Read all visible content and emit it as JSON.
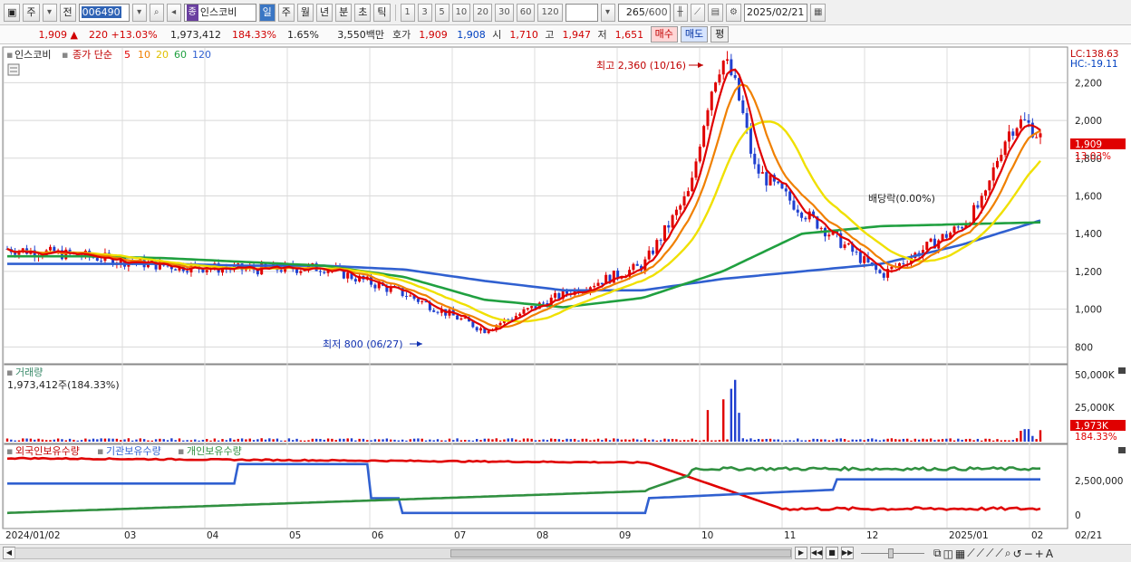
{
  "toolbar": {
    "market_label": "주",
    "prev_label": "전",
    "code": "006490",
    "stock_tag": "종",
    "stock_name": "인스코비",
    "periods": [
      "일",
      "주",
      "월",
      "년",
      "분",
      "초",
      "틱"
    ],
    "selected_period": "일",
    "intervals": [
      "1",
      "3",
      "5",
      "10",
      "20",
      "30",
      "60",
      "120"
    ],
    "count_display": "265",
    "count_total": "/600",
    "date": "2025/02/21"
  },
  "quote": {
    "price": "1,909",
    "arrow": "▲",
    "change": "220",
    "change_pct": "+13.03%",
    "volume": "1,973,412",
    "volume_ratio": "184.33%",
    "turnover": "1.65%",
    "amount": "3,550백만",
    "hoga_label": "호가",
    "ask": "1,909",
    "bid": "1,908",
    "open_label": "시",
    "open": "1,710",
    "high_label": "고",
    "high": "1,947",
    "low_label": "저",
    "low": "1,651",
    "buy_label": "매수",
    "sell_label": "매도",
    "avg_label": "평"
  },
  "price_panel": {
    "legend_name": "인스코비",
    "legend_type": "종가 단순",
    "ma_periods": [
      "5",
      "10",
      "20",
      "60",
      "120"
    ],
    "lc_label": "LC:138.63",
    "hc_label": "HC:-19.11",
    "last_price_label": "1,909",
    "last_pct_label": "13.03%",
    "high_annotation": "최고 2,360 (10/16)",
    "low_annotation": "최저 800 (06/27)",
    "dividend_annotation": "배당락(0.00%)",
    "y_ticks": [
      "2,200",
      "2,000",
      "1,800",
      "1,600",
      "1,400",
      "1,200",
      "1,000",
      "800"
    ]
  },
  "volume_panel": {
    "title": "거래량",
    "value_label": "1,973,412주(184.33%)",
    "y_ticks": [
      "50,000K",
      "25,000K"
    ],
    "last_label": "1,973K",
    "last_pct": "184.33%"
  },
  "holdings_panel": {
    "legend": [
      "외국인보유수량",
      "기관보유수량",
      "개인보유수량"
    ],
    "y_ticks": [
      "2,500,000",
      "0"
    ]
  },
  "x_axis": {
    "labels": [
      "2024/01/02",
      "03",
      "04",
      "05",
      "06",
      "07",
      "08",
      "09",
      "10",
      "11",
      "12",
      "2025/01",
      "02"
    ],
    "right_label": "02/21"
  },
  "colors": {
    "ma5": "#e00000",
    "ma10": "#f08000",
    "ma20": "#f0e000",
    "ma60": "#20a040",
    "ma120": "#3060d0",
    "up": "#e00000",
    "down": "#2040d0",
    "foreign": "#e00000",
    "institution": "#3060d0",
    "individual": "#309040"
  },
  "chart_data": {
    "type": "line",
    "title": "",
    "xlabel": "",
    "ylabel": "",
    "x": [
      "2024/01",
      "2024/02",
      "2024/03",
      "2024/04",
      "2024/05",
      "2024/06",
      "2024/07",
      "2024/08",
      "2024/09",
      "2024/10",
      "2024/11",
      "2024/12",
      "2025/01",
      "2025/02"
    ],
    "ylim": [
      720,
      2360
    ],
    "series": [
      {
        "name": "종가",
        "values": [
          1320,
          1280,
          1230,
          1210,
          1220,
          1080,
          890,
          1080,
          1230,
          1900,
          1520,
          1180,
          1440,
          1909
        ]
      },
      {
        "name": "60",
        "values": [
          1280,
          1280,
          1270,
          1250,
          1230,
          1170,
          1050,
          1010,
          1060,
          1200,
          1400,
          1440,
          1450,
          1460
        ]
      },
      {
        "name": "120",
        "values": [
          1240,
          1240,
          1240,
          1230,
          1230,
          1210,
          1150,
          1100,
          1100,
          1160,
          1200,
          1240,
          1340,
          1470
        ]
      }
    ],
    "volume_ylim": [
      0,
      55000
    ],
    "volume_spikes": [
      {
        "x": "2024/10",
        "value": 48000
      },
      {
        "x": "2025/02",
        "value": 10000
      }
    ]
  }
}
